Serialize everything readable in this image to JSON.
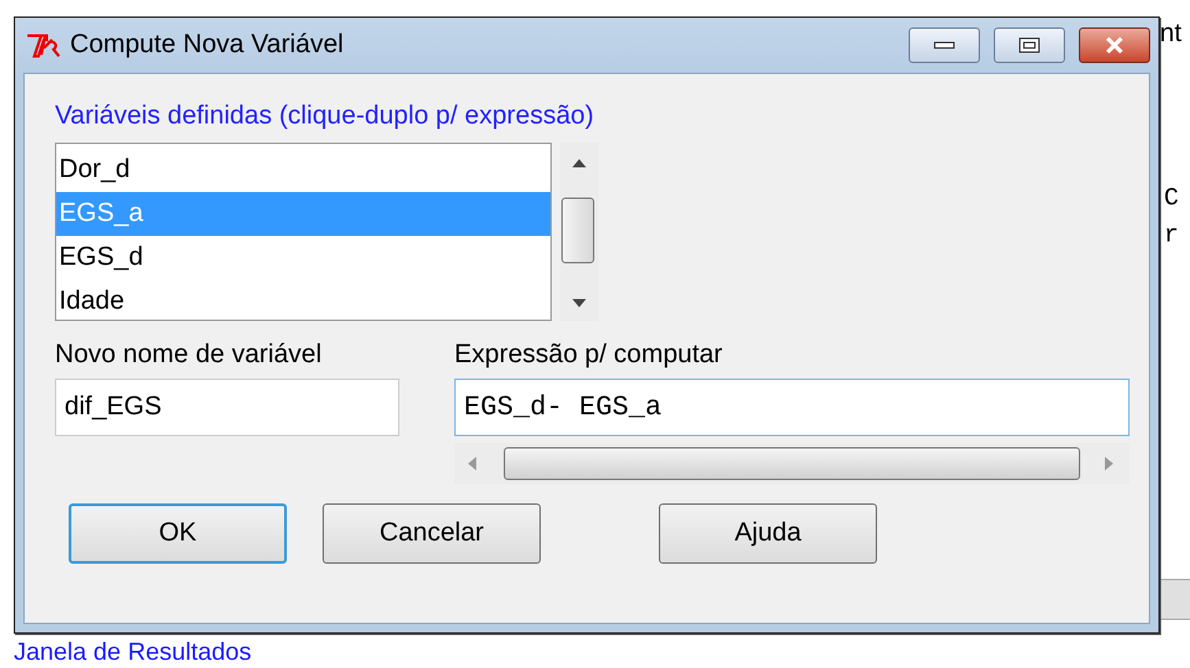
{
  "background": {
    "top_text": "nt",
    "lines": [
      "C",
      "r"
    ],
    "bottom_label": "Janela de Resultados"
  },
  "window": {
    "title": "Compute Nova Variável"
  },
  "variables": {
    "label": "Variáveis definidas (clique-duplo p/ expressão)",
    "items": [
      {
        "name": "Dor_d",
        "selected": false
      },
      {
        "name": "EGS_a",
        "selected": true
      },
      {
        "name": "EGS_d",
        "selected": false
      },
      {
        "name": "Idade",
        "selected": false
      }
    ]
  },
  "new_name": {
    "label": "Novo nome de variável",
    "value": "dif_EGS"
  },
  "expression": {
    "label": "Expressão p/ computar",
    "value": "EGS_d- EGS_a"
  },
  "buttons": [
    {
      "label": "OK",
      "default": true
    },
    {
      "label": "Cancelar",
      "default": false
    },
    {
      "label": "Ajuda",
      "default": false
    }
  ]
}
